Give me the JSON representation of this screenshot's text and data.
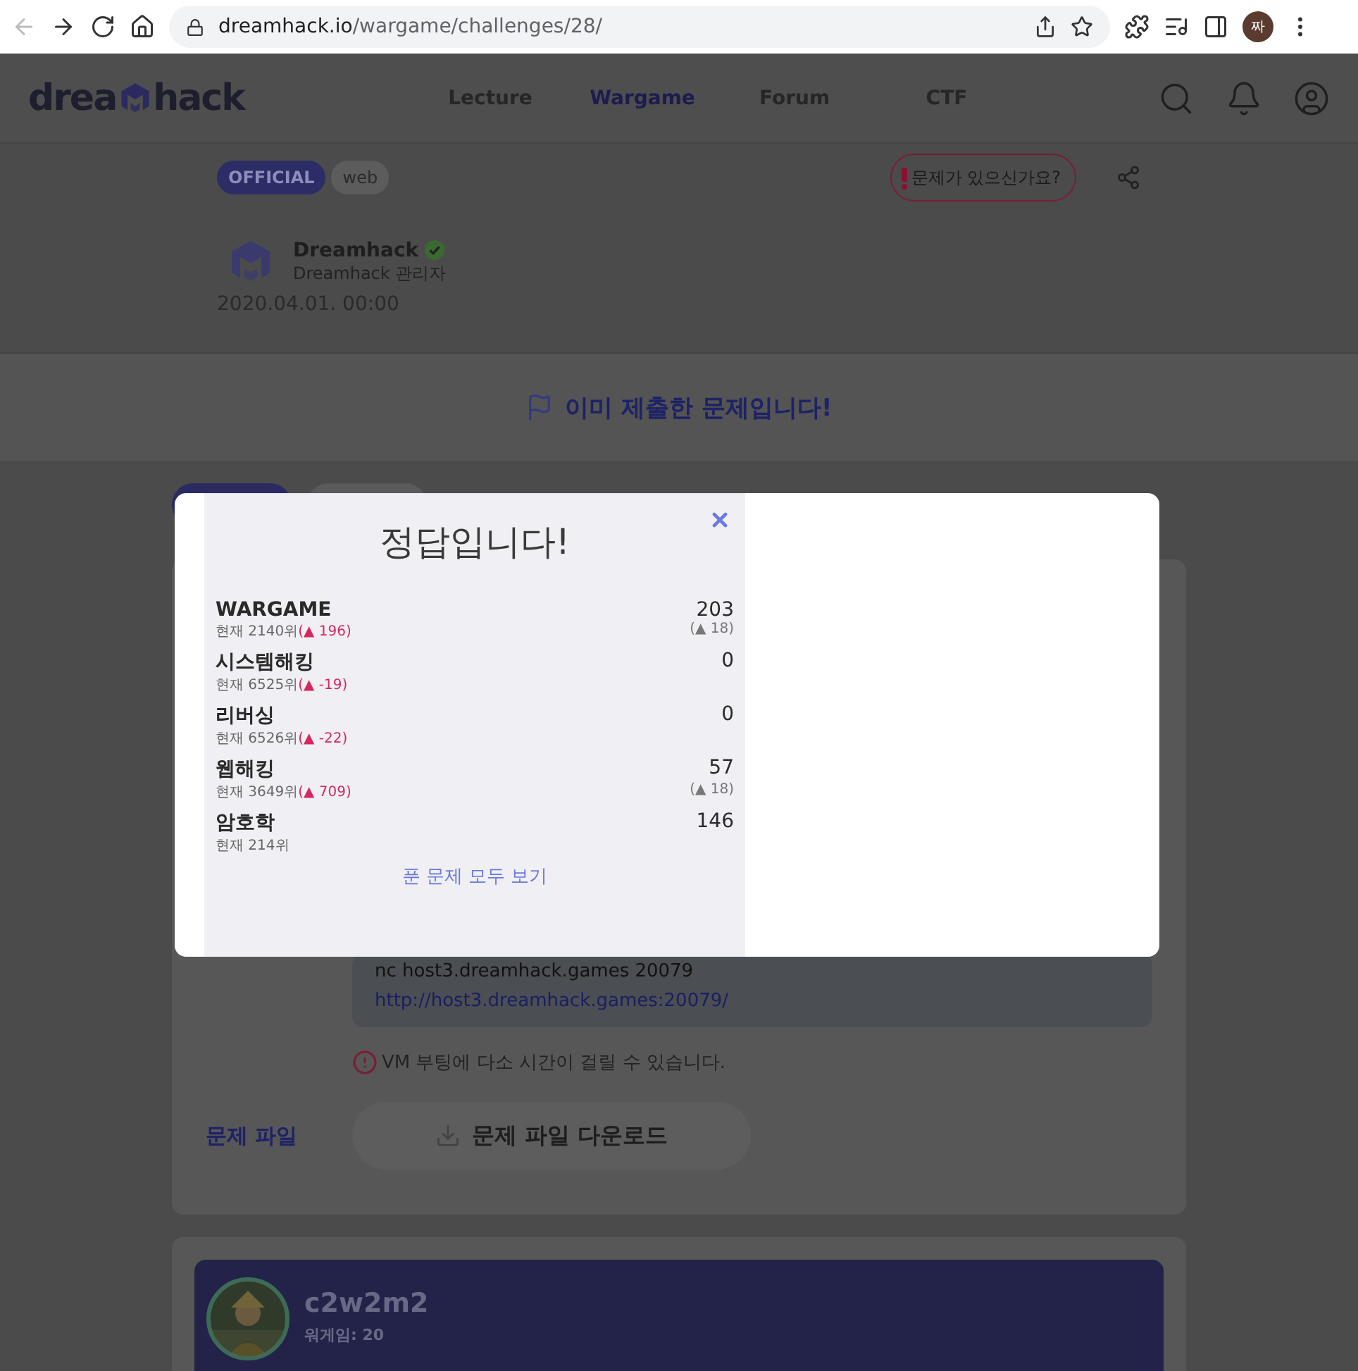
{
  "browser": {
    "url_host": "dreamhack.io",
    "url_path": "/wargame/challenges/28/",
    "profile_initial": "짜"
  },
  "nav": {
    "logo_before": "drea",
    "logo_after": "hack",
    "items": [
      {
        "label": "Lecture",
        "selected": false
      },
      {
        "label": "Wargame",
        "selected": true
      },
      {
        "label": "Forum",
        "selected": false
      },
      {
        "label": "CTF",
        "selected": false
      }
    ]
  },
  "challenge": {
    "tags": [
      {
        "label": "OFFICIAL",
        "kind": "official"
      },
      {
        "label": "web",
        "kind": "category"
      }
    ],
    "report_button": "문제가 있으신가요?",
    "author": {
      "name": "Dreamhack",
      "role": "Dreamhack 관리자",
      "verified": true
    },
    "date": "2020.04.01. 00:00",
    "banner": "이미 제출한 문제입니다!"
  },
  "tabs": [
    {
      "selected": true
    },
    {
      "selected": false
    }
  ],
  "connection": {
    "command": "nc host3.dreamhack.games 20079",
    "link": "http://host3.dreamhack.games:20079/"
  },
  "vm_notice": "VM 부팅에 다소 시간이 걸릴 수 있습니다.",
  "file_label": "문제 파일",
  "download_button": "문제 파일 다운로드",
  "comment": {
    "user": "c2w2m2",
    "sub": "워게임: 20"
  },
  "modal": {
    "title": "정답입니다!",
    "link": "푼 문제 모두 보기",
    "rows": [
      {
        "name": "WARGAME",
        "score": "203",
        "rank": "현재 2140위",
        "change": "(▲ 196)",
        "gain": "(▲ 18)"
      },
      {
        "name": "시스템해킹",
        "score": "0",
        "rank": "현재 6525위",
        "change": "(▲ -19)"
      },
      {
        "name": "리버싱",
        "score": "0",
        "rank": "현재 6526위",
        "change": "(▲ -22)"
      },
      {
        "name": "웹해킹",
        "score": "57",
        "rank": "현재 3649위",
        "change": "(▲ 709)",
        "gain": "(▲ 18)"
      },
      {
        "name": "암호학",
        "score": "146",
        "rank": "현재 214위"
      }
    ]
  }
}
